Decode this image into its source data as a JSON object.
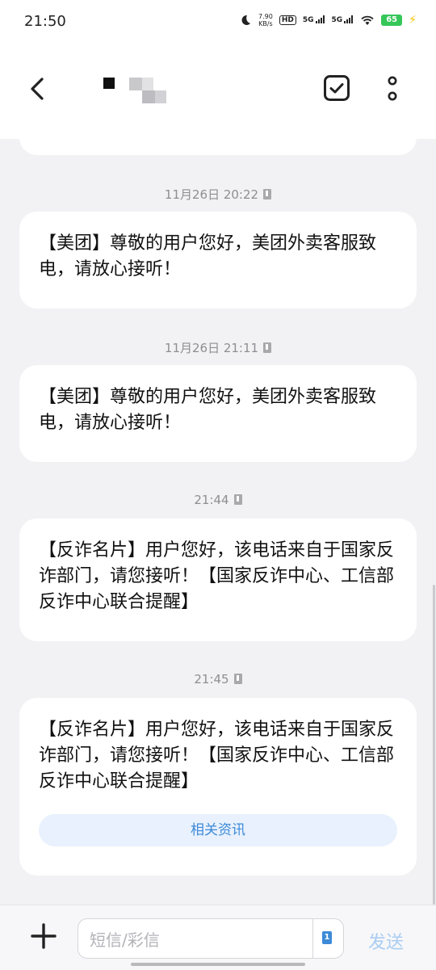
{
  "status_bar": {
    "time": "21:50",
    "net_speed_value": "7.90",
    "net_speed_unit": "KB/s",
    "hd_label": "HD",
    "signal_1": "5G",
    "signal_2": "5G",
    "battery": "65"
  },
  "header": {
    "contact_name_masked": true
  },
  "messages": [
    {
      "timestamp": "11月26日 20:22",
      "text": "【美团】尊敬的用户您好，美团外卖客服致电，请放心接听！"
    },
    {
      "timestamp": "11月26日 21:11",
      "text": "【美团】尊敬的用户您好，美团外卖客服致电，请放心接听！"
    },
    {
      "timestamp": "21:44",
      "text": "【反诈名片】用户您好，该电话来自于国家反诈部门，请您接听！【国家反诈中心、工信部反诈中心联合提醒】"
    },
    {
      "timestamp": "21:45",
      "text": "【反诈名片】用户您好，该电话来自于国家反诈部门，请您接听！【国家反诈中心、工信部反诈中心联合提醒】",
      "action": "相关资讯"
    }
  ],
  "composer": {
    "placeholder": "短信/彩信",
    "value": "",
    "sim_slot": "1",
    "send_label": "发送"
  },
  "colors": {
    "accent": "#3d8ad8",
    "send_disabled": "#a9cdf2",
    "background": "#f2f2f4",
    "bubble": "#ffffff"
  }
}
